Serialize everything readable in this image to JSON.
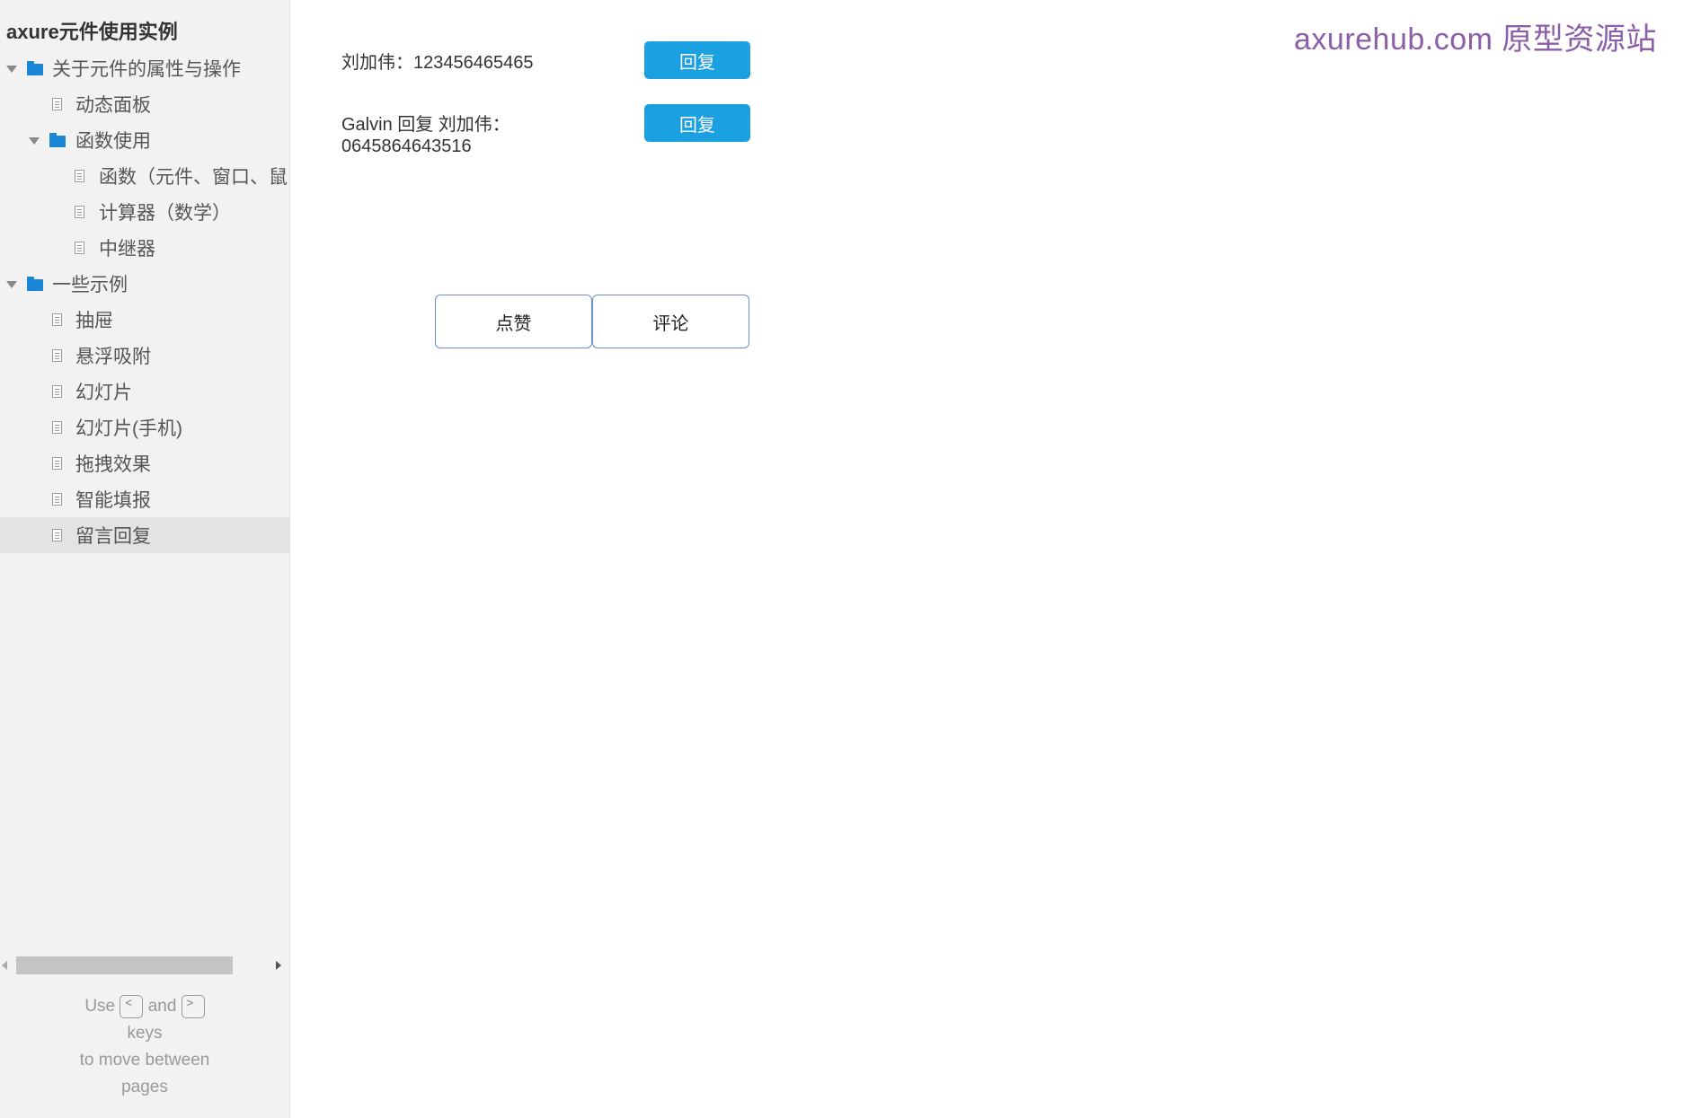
{
  "sidebar": {
    "title": "axure元件使用实例",
    "tree": [
      {
        "label": "关于元件的属性与操作"
      },
      {
        "label": "动态面板"
      },
      {
        "label": "函数使用"
      },
      {
        "label": "函数（元件、窗口、鼠"
      },
      {
        "label": "计算器（数学）"
      },
      {
        "label": "中继器"
      },
      {
        "label": "一些示例"
      },
      {
        "label": "抽屉"
      },
      {
        "label": "悬浮吸附"
      },
      {
        "label": "幻灯片"
      },
      {
        "label": "幻灯片(手机)"
      },
      {
        "label": "拖拽效果"
      },
      {
        "label": "智能填报"
      },
      {
        "label": "留言回复"
      }
    ],
    "help": {
      "use": "Use",
      "key_prev": "<",
      "and": "and",
      "key_next": ">",
      "keys": "keys",
      "line2": "to move between",
      "line3": "pages"
    }
  },
  "watermark": "axurehub.com 原型资源站",
  "messages": [
    {
      "text": "刘加伟：123456465465",
      "reply_label": "回复"
    },
    {
      "text": "Galvin 回复 刘加伟：\n0645864643516",
      "reply_label": "回复"
    }
  ],
  "actions": {
    "like_label": "点赞",
    "comment_label": "评论"
  }
}
